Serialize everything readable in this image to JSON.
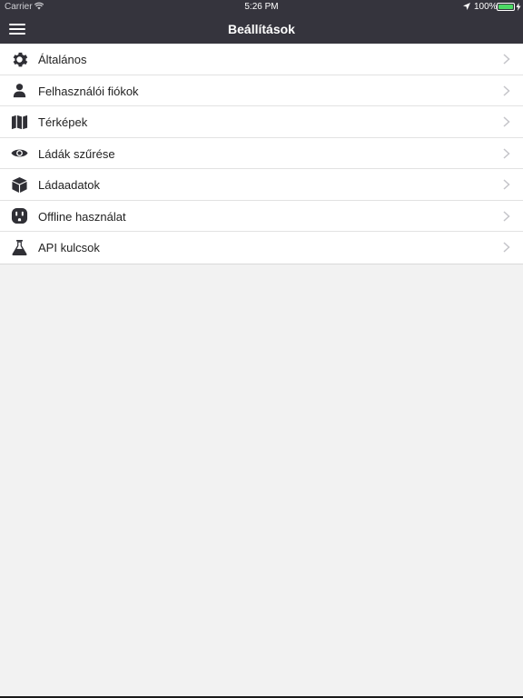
{
  "status_bar": {
    "carrier": "Carrier",
    "time": "5:26 PM",
    "battery": "100%",
    "battery_color": "#4cd964"
  },
  "nav": {
    "title": "Beállítások",
    "menu_icon": "hamburger-menu-icon",
    "bg_color": "#35343d"
  },
  "settings": {
    "items": [
      {
        "label": "Általános",
        "icon": "gear-icon"
      },
      {
        "label": "Felhasználói fiókok",
        "icon": "user-icon"
      },
      {
        "label": "Térképek",
        "icon": "map-icon"
      },
      {
        "label": "Ládák szűrése",
        "icon": "eye-icon"
      },
      {
        "label": "Ládaadatok",
        "icon": "box-icon"
      },
      {
        "label": "Offline használat",
        "icon": "power-outlet-icon"
      },
      {
        "label": "API kulcsok",
        "icon": "flask-icon"
      }
    ]
  }
}
